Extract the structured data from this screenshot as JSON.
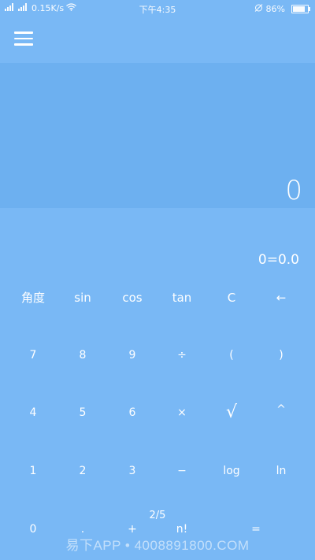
{
  "status_bar": {
    "left_signal": "4G",
    "left_signal2": "4G",
    "speed": "0.15K/s",
    "time": "下午4:35",
    "battery_pct": "86%",
    "battery_level": 0.86
  },
  "display": {
    "value": "0",
    "history": "0=0.0"
  },
  "keys": {
    "row1": [
      "角度",
      "sin",
      "cos",
      "tan",
      "C",
      "←"
    ],
    "row2": [
      "7",
      "8",
      "9",
      "÷",
      "(",
      ")"
    ],
    "row3": [
      "4",
      "5",
      "6",
      "×",
      "√",
      "^"
    ],
    "row4": [
      "1",
      "2",
      "3",
      "−",
      "log",
      "ln"
    ],
    "row5": [
      "0",
      ".",
      "+",
      "n!",
      "="
    ]
  },
  "page_indicator": "2/5",
  "watermark": "易下APP • 4008891800.COM",
  "colors": {
    "background": "#79b8f5",
    "display_panel": "#6db0f0",
    "text": "#ffffff"
  },
  "icons": {
    "menu": "hamburger-menu-icon",
    "wifi": "wifi-icon",
    "alarm": "alarm-off-icon",
    "battery": "battery-icon"
  }
}
